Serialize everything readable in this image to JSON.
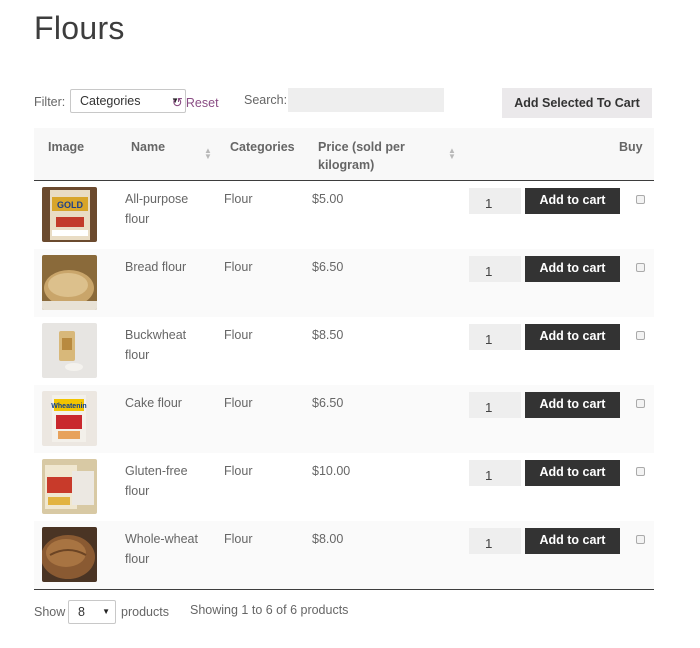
{
  "page": {
    "title": "Flours"
  },
  "toolbar": {
    "filter_label": "Filter:",
    "category_select": "Categories",
    "reset_label": "Reset",
    "search_label": "Search:",
    "search_value": "",
    "add_selected_label": "Add Selected To Cart"
  },
  "table": {
    "headers": {
      "image": "Image",
      "name": "Name",
      "categories": "Categories",
      "price_line1": "Price (sold per",
      "price_line2": "kilogram)",
      "buy": "Buy"
    },
    "add_to_cart_label": "Add to cart",
    "rows": [
      {
        "name_line1": "All-purpose",
        "name_line2": "flour",
        "category": "Flour",
        "price": "$5.00",
        "qty": "1",
        "thumb": "flour-bag-thumbnail",
        "checked": false
      },
      {
        "name_line1": "Bread flour",
        "name_line2": "",
        "category": "Flour",
        "price": "$6.50",
        "qty": "1",
        "thumb": "bread-loaf-thumbnail",
        "checked": false
      },
      {
        "name_line1": "Buckwheat",
        "name_line2": "flour",
        "category": "Flour",
        "price": "$8.50",
        "qty": "1",
        "thumb": "flour-jar-thumbnail",
        "checked": false
      },
      {
        "name_line1": "Cake flour",
        "name_line2": "",
        "category": "Flour",
        "price": "$6.50",
        "qty": "1",
        "thumb": "cake-flour-box-thumbnail",
        "checked": false
      },
      {
        "name_line1": "Gluten-free",
        "name_line2": "flour",
        "category": "Flour",
        "price": "$10.00",
        "qty": "1",
        "thumb": "gluten-free-bag-thumbnail",
        "checked": false
      },
      {
        "name_line1": "Whole-wheat",
        "name_line2": "flour",
        "category": "Flour",
        "price": "$8.00",
        "qty": "1",
        "thumb": "whole-wheat-bread-thumbnail",
        "checked": false
      }
    ]
  },
  "footer": {
    "show_label": "Show",
    "per_page": "8",
    "products_label": "products",
    "showing_text": "Showing 1 to 6 of 6 products"
  },
  "colors": {
    "accent_link": "#8a4d84",
    "button_dark": "#333333",
    "button_light": "#ebe9eb",
    "header_bg": "#f8f8f8"
  }
}
